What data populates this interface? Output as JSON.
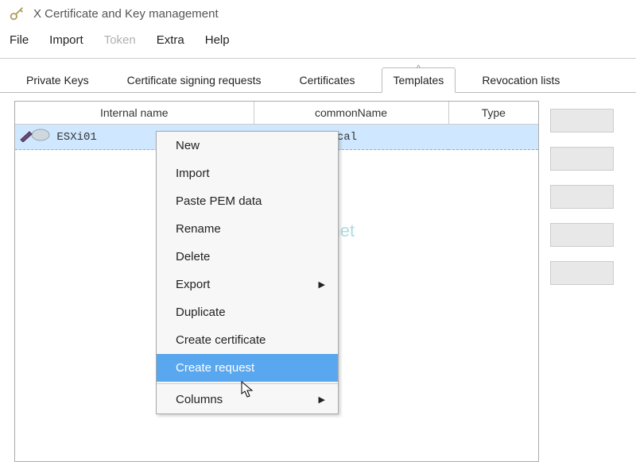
{
  "window": {
    "title": "X Certificate and Key management"
  },
  "menubar": {
    "items": [
      {
        "label": "File",
        "dim": false
      },
      {
        "label": "Import",
        "dim": false
      },
      {
        "label": "Token",
        "dim": true
      },
      {
        "label": "Extra",
        "dim": false
      },
      {
        "label": "Help",
        "dim": false
      }
    ]
  },
  "tabs": {
    "items": [
      {
        "label": "Private Keys",
        "active": false
      },
      {
        "label": "Certificate signing requests",
        "active": false
      },
      {
        "label": "Certificates",
        "active": false
      },
      {
        "label": "Templates",
        "active": true
      },
      {
        "label": "Revocation lists",
        "active": false
      }
    ]
  },
  "table": {
    "columns": [
      "Internal name",
      "commonName",
      "Type"
    ],
    "rows": [
      {
        "internal_name": "ESXi01",
        "common_name": ".wojciech.local",
        "type": "",
        "selected": true
      }
    ]
  },
  "context_menu": {
    "items": [
      {
        "label": "New",
        "submenu": false
      },
      {
        "label": "Import",
        "submenu": false
      },
      {
        "label": "Paste PEM data",
        "submenu": false
      },
      {
        "label": "Rename",
        "submenu": false
      },
      {
        "label": "Delete",
        "submenu": false
      },
      {
        "label": "Export",
        "submenu": true
      },
      {
        "label": "Duplicate",
        "submenu": false
      },
      {
        "label": "Create certificate",
        "submenu": false
      },
      {
        "label": "Create request",
        "submenu": false,
        "highlight": true
      },
      {
        "sep": true
      },
      {
        "label": "Columns",
        "submenu": true
      }
    ]
  },
  "watermark": "http://wojciech.net",
  "icons": {
    "key": "key-icon"
  }
}
